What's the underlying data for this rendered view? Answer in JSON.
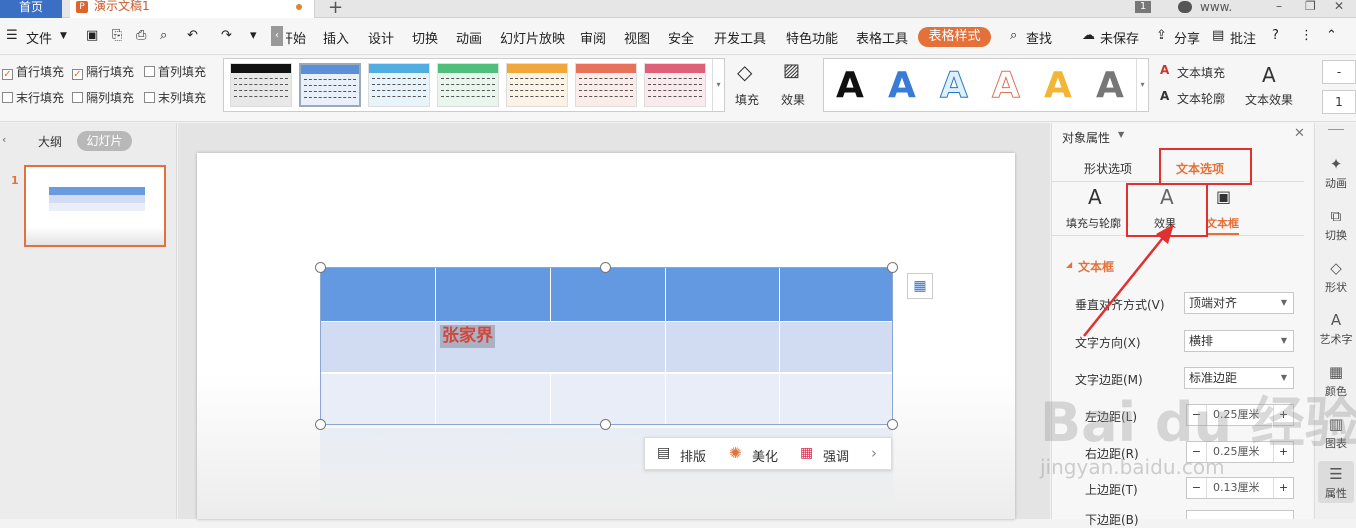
{
  "tabs": {
    "home": "首页",
    "doc": "演示文稿1",
    "page_badge": "1",
    "user": "www."
  },
  "menu": {
    "file": "文件",
    "items": [
      "开始",
      "插入",
      "设计",
      "切换",
      "动画",
      "幻灯片放映",
      "审阅",
      "视图",
      "安全",
      "开发工具",
      "特色功能",
      "表格工具"
    ],
    "active": "表格样式",
    "search": "查找",
    "unsaved": "未保存",
    "share": "分享",
    "comment": "批注"
  },
  "ribbon": {
    "checks": [
      {
        "label": "首行填充",
        "checked": true
      },
      {
        "label": "隔行填充",
        "checked": true
      },
      {
        "label": "首列填充",
        "checked": false
      },
      {
        "label": "末行填充",
        "checked": false
      },
      {
        "label": "隔列填充",
        "checked": false
      },
      {
        "label": "末列填充",
        "checked": false
      }
    ],
    "swatch_colors": [
      "#111111",
      "#5b8fd8",
      "#52aee0",
      "#4fbf7b",
      "#f0a83c",
      "#e8735a",
      "#e0607a"
    ],
    "fill": "填充",
    "effect": "效果",
    "wordart_letter": "A",
    "wordart_colors": [
      "#111111",
      "#3b7bd8",
      "#5ab4e8",
      "#f2a08a",
      "#f2b535",
      "#777777"
    ],
    "text_fill": "文本填充",
    "text_outline": "文本轮廓",
    "text_effect": "文本效果",
    "font_size": "1"
  },
  "left_panel": {
    "outline": "大纲",
    "slides": "幻灯片",
    "slide_number": "1"
  },
  "slide": {
    "cell_text": "张家界"
  },
  "float_bar": {
    "layout": "排版",
    "beautify": "美化",
    "emphasis": "强调"
  },
  "props": {
    "title": "对象属性",
    "tab_shape": "形状选项",
    "tab_text": "文本选项",
    "sub_fill": "填充与轮廓",
    "sub_effect": "效果",
    "sub_textbox": "文本框",
    "section": "文本框",
    "v_align_label": "垂直对齐方式(V)",
    "v_align_value": "顶端对齐",
    "direction_label": "文字方向(X)",
    "direction_value": "横排",
    "margin_label": "文字边距(M)",
    "margin_value": "标准边距",
    "left_label": "左边距(L)",
    "left_value": "0.25厘米",
    "right_label": "右边距(R)",
    "right_value": "0.25厘米",
    "top_label": "上边距(T)",
    "top_value": "0.13厘米",
    "bottom_label": "下边距(B)"
  },
  "sidebar": [
    "动画",
    "切换",
    "形状",
    "艺术字",
    "颜色",
    "图表",
    "属性"
  ],
  "watermark": {
    "main": "Bai du 经验",
    "sub": "jingyan.baidu.com"
  }
}
